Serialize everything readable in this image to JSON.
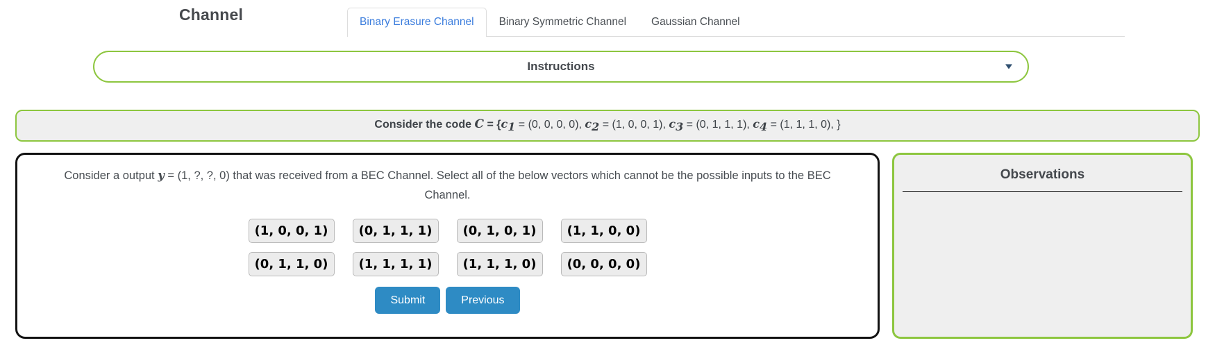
{
  "header": {
    "title": "Channel",
    "tabs": [
      {
        "label": "Binary Erasure Channel",
        "active": true
      },
      {
        "label": "Binary Symmetric Channel",
        "active": false
      },
      {
        "label": "Gaussian Channel",
        "active": false
      }
    ]
  },
  "instructions": {
    "label": "Instructions",
    "icon": "chevron-down-icon",
    "expanded": false
  },
  "code_banner": {
    "prefix": "Consider the code",
    "set_symbol": "C",
    "equals": "=",
    "open_brace": "{",
    "codewords": [
      {
        "name": "c",
        "index": "1",
        "value": "(0, 0, 0, 0)"
      },
      {
        "name": "c",
        "index": "2",
        "value": "(1, 0, 0, 1)"
      },
      {
        "name": "c",
        "index": "3",
        "value": "(0, 1, 1, 1)"
      },
      {
        "name": "c",
        "index": "4",
        "value": "(1, 1, 1, 0)"
      }
    ],
    "close_brace": "}",
    "full_text": "Consider the code C = {c1 = (0, 0, 0, 0), c2 = (1, 0, 0, 1), c3 = (0, 1, 1, 1), c4 = (1, 1, 1, 0), }"
  },
  "question": {
    "text_before_y": "Consider a output ",
    "y_symbol": "y",
    "text_after_y": " = (1, ?, ?, 0) that was received from a BEC Channel. Select all of the below vectors which cannot be the possible inputs to the BEC Channel.",
    "output_vector": "(1, ?, ?, 0)",
    "channel": "BEC Channel",
    "options_row1": [
      "(1, 0, 0, 1)",
      "(0, 1, 1, 1)",
      "(0, 1, 0, 1)",
      "(1, 1, 0, 0)"
    ],
    "options_row2": [
      "(0, 1, 1, 0)",
      "(1, 1, 1, 1)",
      "(1, 1, 1, 0)",
      "(0, 0, 0, 0)"
    ],
    "submit_label": "Submit",
    "previous_label": "Previous"
  },
  "observations": {
    "title": "Observations",
    "entries": []
  },
  "colors": {
    "green_border": "#8dc63f",
    "blue_button": "#2e8bc4",
    "active_tab_text": "#3b7ddd",
    "panel_gray": "#efefef",
    "option_gray": "#ececec"
  }
}
